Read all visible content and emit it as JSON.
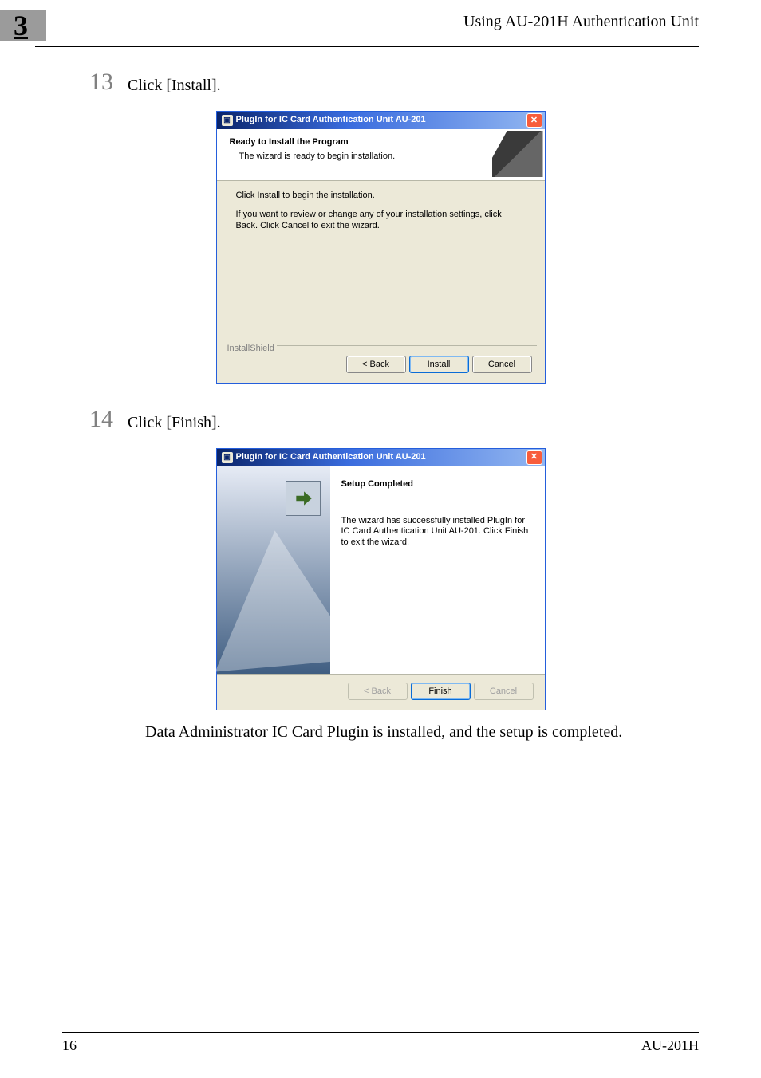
{
  "chapter_number": "3",
  "header": {
    "right": "Using AU-201H Authentication Unit"
  },
  "step13": {
    "num": "13",
    "text": "Click [Install]."
  },
  "step14": {
    "num": "14",
    "text": "Click [Finish]."
  },
  "dialog1": {
    "title": "PlugIn for IC Card Authentication Unit AU-201",
    "hdr_title": "Ready to Install the Program",
    "hdr_sub": "The wizard is ready to begin installation.",
    "body_p1": "Click Install to begin the installation.",
    "body_p2": "If you want to review or change any of your installation settings, click Back. Click Cancel to exit the wizard.",
    "brand": "InstallShield",
    "buttons": {
      "back": "< Back",
      "install": "Install",
      "cancel": "Cancel"
    }
  },
  "dialog2": {
    "title": "PlugIn for IC Card Authentication Unit AU-201",
    "hdr_title": "Setup Completed",
    "msg": "The wizard has successfully installed PlugIn for IC Card Authentication Unit AU-201. Click Finish to exit the wizard.",
    "buttons": {
      "back": "< Back",
      "finish": "Finish",
      "cancel": "Cancel"
    }
  },
  "closing_para": "Data Administrator IC Card Plugin is installed, and the setup is completed.",
  "footer": {
    "left": "16",
    "right": "AU-201H"
  }
}
